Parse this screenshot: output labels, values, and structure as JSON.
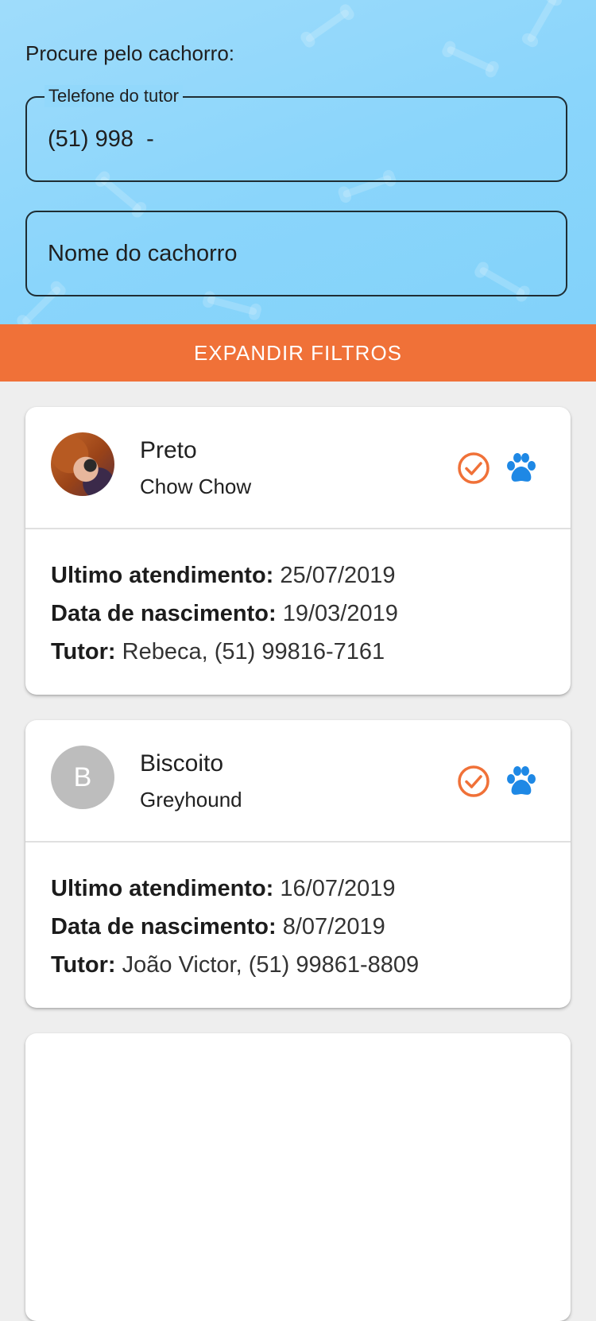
{
  "search": {
    "label": "Procure pelo cachorro:",
    "phone_field": {
      "legend": "Telefone do tutor",
      "value": "(51) 998  -"
    },
    "name_field": {
      "placeholder": "Nome do cachorro"
    }
  },
  "expand_button": {
    "label": "EXPANDIR FILTROS"
  },
  "colors": {
    "header_background": "#8fd7fb",
    "accent_orange": "#f07138",
    "paw_blue": "#1e88e5",
    "avatar_gray": "#bdbdbd"
  },
  "dogs": [
    {
      "name": "Preto",
      "breed": "Chow Chow",
      "avatar": "dog-photo",
      "status_icon": "check-circle-icon",
      "type_icon": "paw-icon",
      "last_visit_label": "Ultimo atendimento:",
      "last_visit": "25/07/2019",
      "birth_label": "Data de nascimento:",
      "birth_date": "19/03/2019",
      "tutor_label": "Tutor:",
      "tutor": "Rebeca, (51) 99816-7161"
    },
    {
      "name": "Biscoito",
      "breed": "Greyhound",
      "avatar_letter": "B",
      "status_icon": "check-circle-icon",
      "type_icon": "paw-icon",
      "last_visit_label": "Ultimo atendimento:",
      "last_visit": "16/07/2019",
      "birth_label": "Data de nascimento:",
      "birth_date": "8/07/2019",
      "tutor_label": "Tutor:",
      "tutor": "João Victor, (51) 99861-8809"
    }
  ]
}
